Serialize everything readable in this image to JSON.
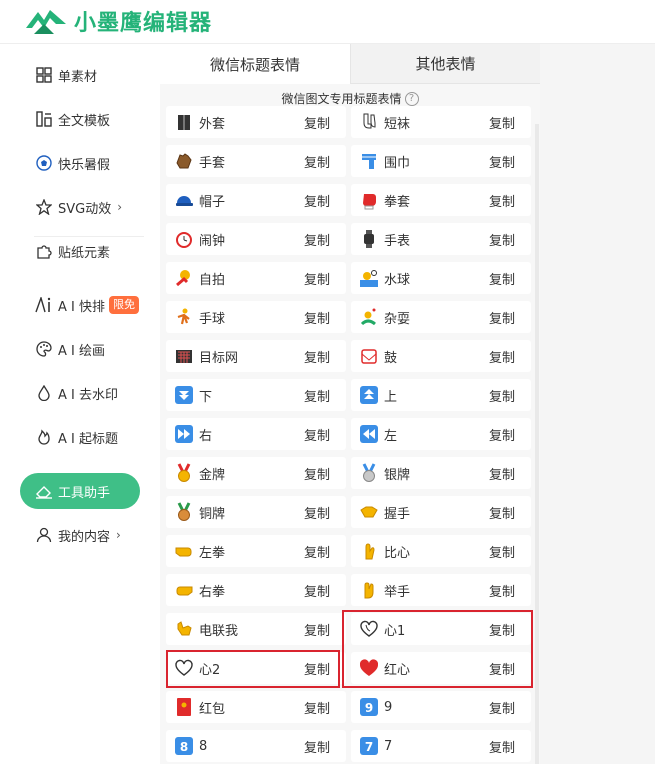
{
  "app": {
    "logo_text": "小墨鹰编辑器"
  },
  "sidebar": {
    "items": [
      {
        "label": "单素材",
        "icon": "grid-icon"
      },
      {
        "label": "全文模板",
        "icon": "template-icon"
      },
      {
        "label": "快乐暑假",
        "icon": "soccer-ball-icon"
      },
      {
        "label": "SVG动效",
        "icon": "star-outline-icon",
        "chevron": "›"
      },
      {
        "label": "贴纸元素",
        "icon": "puzzle-icon"
      },
      {
        "label": "A I 快排",
        "icon": "ai-icon",
        "badge": "限免"
      },
      {
        "label": "A I 绘画",
        "icon": "palette-icon"
      },
      {
        "label": "A I 去水印",
        "icon": "drop-icon"
      },
      {
        "label": "A I 起标题",
        "icon": "flame-icon"
      },
      {
        "label": "工具助手",
        "icon": "eraser-icon",
        "active": true
      },
      {
        "label": "我的内容",
        "icon": "user-icon",
        "chevron": "›"
      }
    ]
  },
  "tabs": [
    {
      "label": "微信标题表情",
      "active": true
    },
    {
      "label": "其他表情",
      "active": false
    }
  ],
  "subtitle": "微信图文专用标题表情",
  "help_glyph": "?",
  "copy_label": "复制",
  "rows": [
    {
      "left": {
        "name": "外套",
        "emoji": "coat-icon"
      },
      "right": {
        "name": "短袜",
        "emoji": "socks-icon"
      }
    },
    {
      "left": {
        "name": "手套",
        "emoji": "gloves-icon"
      },
      "right": {
        "name": "围巾",
        "emoji": "scarf-icon"
      }
    },
    {
      "left": {
        "name": "帽子",
        "emoji": "cap-icon"
      },
      "right": {
        "name": "拳套",
        "emoji": "boxing-glove-icon"
      }
    },
    {
      "left": {
        "name": "闹钟",
        "emoji": "alarm-clock-icon"
      },
      "right": {
        "name": "手表",
        "emoji": "watch-icon"
      }
    },
    {
      "left": {
        "name": "自拍",
        "emoji": "selfie-icon"
      },
      "right": {
        "name": "水球",
        "emoji": "water-polo-icon"
      }
    },
    {
      "left": {
        "name": "手球",
        "emoji": "handball-icon"
      },
      "right": {
        "name": "杂耍",
        "emoji": "juggling-icon"
      }
    },
    {
      "left": {
        "name": "目标网",
        "emoji": "goal-net-icon"
      },
      "right": {
        "name": "鼓",
        "emoji": "drum-icon"
      }
    },
    {
      "left": {
        "name": "下",
        "emoji": "down-arrow-icon"
      },
      "right": {
        "name": "上",
        "emoji": "up-arrow-icon"
      }
    },
    {
      "left": {
        "name": "右",
        "emoji": "fast-forward-icon"
      },
      "right": {
        "name": "左",
        "emoji": "rewind-icon"
      }
    },
    {
      "left": {
        "name": "金牌",
        "emoji": "gold-medal-icon"
      },
      "right": {
        "name": "银牌",
        "emoji": "silver-medal-icon"
      }
    },
    {
      "left": {
        "name": "铜牌",
        "emoji": "bronze-medal-icon"
      },
      "right": {
        "name": "握手",
        "emoji": "handshake-icon"
      }
    },
    {
      "left": {
        "name": "左拳",
        "emoji": "left-fist-icon"
      },
      "right": {
        "name": "比心",
        "emoji": "crossed-fingers-icon"
      }
    },
    {
      "left": {
        "name": "右拳",
        "emoji": "right-fist-icon"
      },
      "right": {
        "name": "举手",
        "emoji": "raised-hand-icon"
      }
    },
    {
      "left": {
        "name": "电联我",
        "emoji": "call-me-hand-icon"
      },
      "right": {
        "name": "心1",
        "emoji": "heart-outline-icon",
        "highlighted": true
      }
    },
    {
      "left": {
        "name": "心2",
        "emoji": "heart-outline-2-icon",
        "highlighted": true
      },
      "right": {
        "name": "红心",
        "emoji": "red-heart-icon",
        "highlighted": true
      }
    },
    {
      "left": {
        "name": "红包",
        "emoji": "red-envelope-icon"
      },
      "right": {
        "name": "9",
        "emoji": "keycap-9-icon"
      }
    },
    {
      "left": {
        "name": "8",
        "emoji": "keycap-8-icon"
      },
      "right": {
        "name": "7",
        "emoji": "keycap-7-icon"
      }
    }
  ],
  "colors": {
    "brand": "#25b379",
    "active_nav": "#3fbf87",
    "highlight": "#d9242f",
    "badge": "#ff6f3d"
  }
}
